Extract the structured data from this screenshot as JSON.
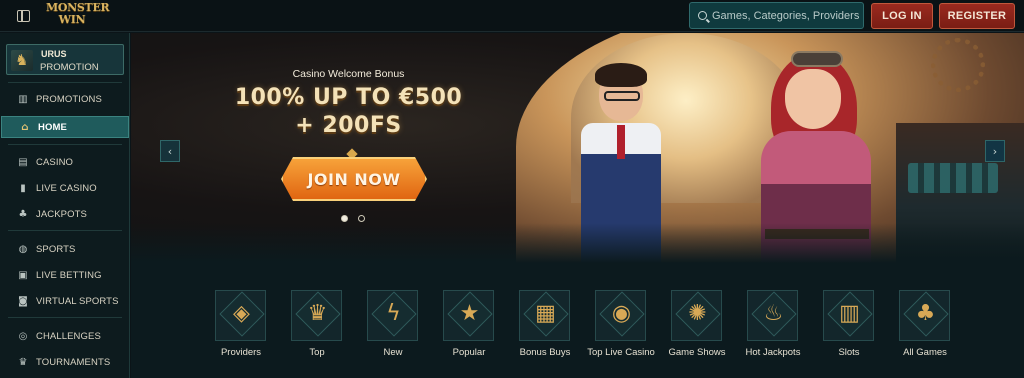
{
  "header": {
    "logo_line1": "MONSTER",
    "logo_line2": "WIN",
    "search_placeholder": "Games, Categories, Providers",
    "login_label": "LOG IN",
    "register_label": "REGISTER"
  },
  "sidebar": {
    "promo": {
      "title": "URUS",
      "subtitle": "PROMOTION"
    },
    "items": [
      {
        "label": "PROMOTIONS",
        "icon": "gift-icon",
        "glyph": "🎁"
      },
      {
        "label": "HOME",
        "icon": "home-icon",
        "glyph": "⌂",
        "active": true
      },
      {
        "label": "CASINO",
        "icon": "slot-machine-icon",
        "glyph": "▤"
      },
      {
        "label": "LIVE CASINO",
        "icon": "live-casino-icon",
        "glyph": "▮"
      },
      {
        "label": "JACKPOTS",
        "icon": "clover-icon",
        "glyph": "♣"
      },
      {
        "label": "SPORTS",
        "icon": "ball-icon",
        "glyph": "◍"
      },
      {
        "label": "LIVE BETTING",
        "icon": "live-betting-icon",
        "glyph": "▣"
      },
      {
        "label": "VIRTUAL SPORTS",
        "icon": "virtual-sports-icon",
        "glyph": "◙"
      },
      {
        "label": "CHALLENGES",
        "icon": "challenges-icon",
        "glyph": "◎"
      },
      {
        "label": "TOURNAMENTS",
        "icon": "trophy-icon",
        "glyph": "♛"
      }
    ]
  },
  "banner": {
    "subtitle": "Casino Welcome Bonus",
    "headline_line1": "100% UP TO €500",
    "headline_line2": "+ 200FS",
    "cta_label": "JOIN NOW",
    "slide_count": 2,
    "active_slide": 1
  },
  "categories": [
    {
      "label": "Providers",
      "icon": "providers-icon",
      "glyph": "◈"
    },
    {
      "label": "Top",
      "icon": "crown-icon",
      "glyph": "♛"
    },
    {
      "label": "New",
      "icon": "lightning-icon",
      "glyph": "ϟ"
    },
    {
      "label": "Popular",
      "icon": "star-icon",
      "glyph": "★"
    },
    {
      "label": "Bonus Buys",
      "icon": "chest-icon",
      "glyph": "▦"
    },
    {
      "label": "Top Live Casino",
      "icon": "chip-icon",
      "glyph": "◉"
    },
    {
      "label": "Game Shows",
      "icon": "wheel-icon",
      "glyph": "✺"
    },
    {
      "label": "Hot Jackpots",
      "icon": "flame-icon",
      "glyph": "♨"
    },
    {
      "label": "Slots",
      "icon": "slots-icon",
      "glyph": "▥"
    },
    {
      "label": "All Games",
      "icon": "all-games-icon",
      "glyph": "♣"
    }
  ],
  "colors": {
    "accent": "#1f5b5c",
    "button_red": "#8a2419",
    "cta_orange": "#f08a28",
    "gold": "#d9a956"
  }
}
